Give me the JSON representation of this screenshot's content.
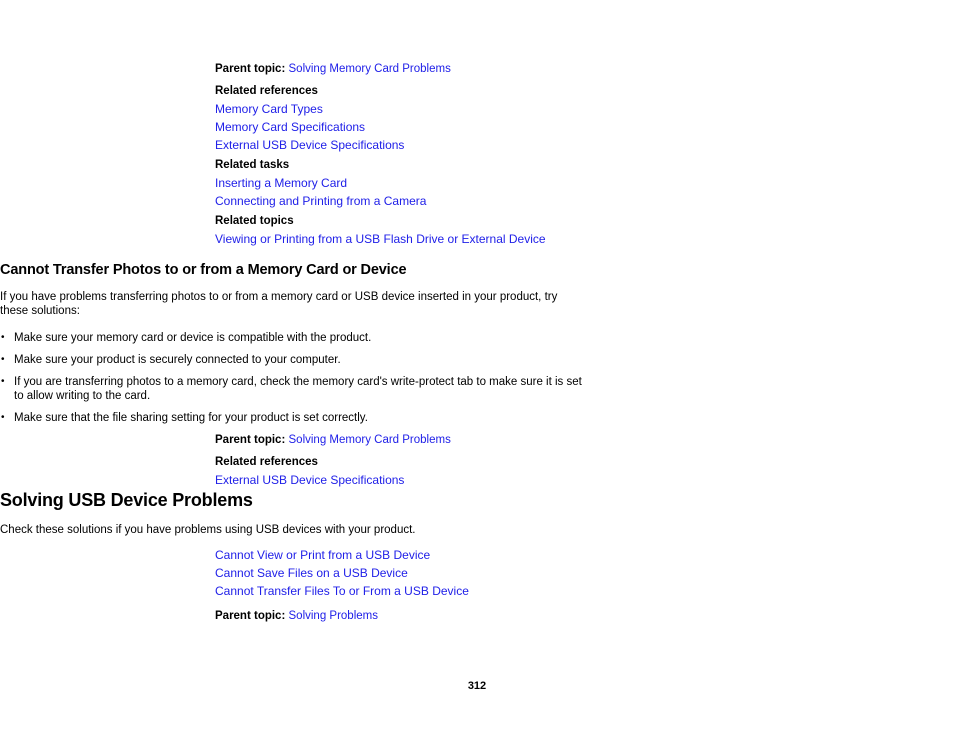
{
  "document": {
    "page_number": "312",
    "link_color": "#2020e8",
    "text_color": "#000000",
    "background_color": "#ffffff"
  },
  "top_section": {
    "parent_topic": {
      "label": "Parent topic:",
      "link": "Solving Memory Card Problems"
    },
    "related_references": {
      "heading": "Related references",
      "links": [
        "Memory Card Types",
        "Memory Card Specifications",
        "External USB Device Specifications"
      ]
    },
    "related_tasks": {
      "heading": "Related tasks",
      "links": [
        "Inserting a Memory Card",
        "Connecting and Printing from a Camera"
      ]
    },
    "related_topics": {
      "heading": "Related topics",
      "links": [
        "Viewing or Printing from a USB Flash Drive or External Device"
      ]
    }
  },
  "cannot_transfer_section": {
    "heading": "Cannot Transfer Photos to or from a Memory Card or Device",
    "intro": "If you have problems transferring photos to or from a memory card or USB device inserted in your product, try these solutions:",
    "bullets": [
      "Make sure your memory card or device is compatible with the product.",
      "Make sure your product is securely connected to your computer.",
      "If you are transferring photos to a memory card, check the memory card's write-protect tab to make sure it is set to allow writing to the card.",
      "Make sure that the file sharing setting for your product is set correctly."
    ],
    "parent_topic": {
      "label": "Parent topic:",
      "link": "Solving Memory Card Problems"
    },
    "related_references": {
      "heading": "Related references",
      "links": [
        "External USB Device Specifications"
      ]
    }
  },
  "usb_section": {
    "heading": "Solving USB Device Problems",
    "intro": "Check these solutions if you have problems using USB devices with your product.",
    "links": [
      "Cannot View or Print from a USB Device",
      "Cannot Save Files on a USB Device",
      "Cannot Transfer Files To or From a USB Device"
    ],
    "parent_topic": {
      "label": "Parent topic:",
      "link": "Solving Problems"
    }
  }
}
